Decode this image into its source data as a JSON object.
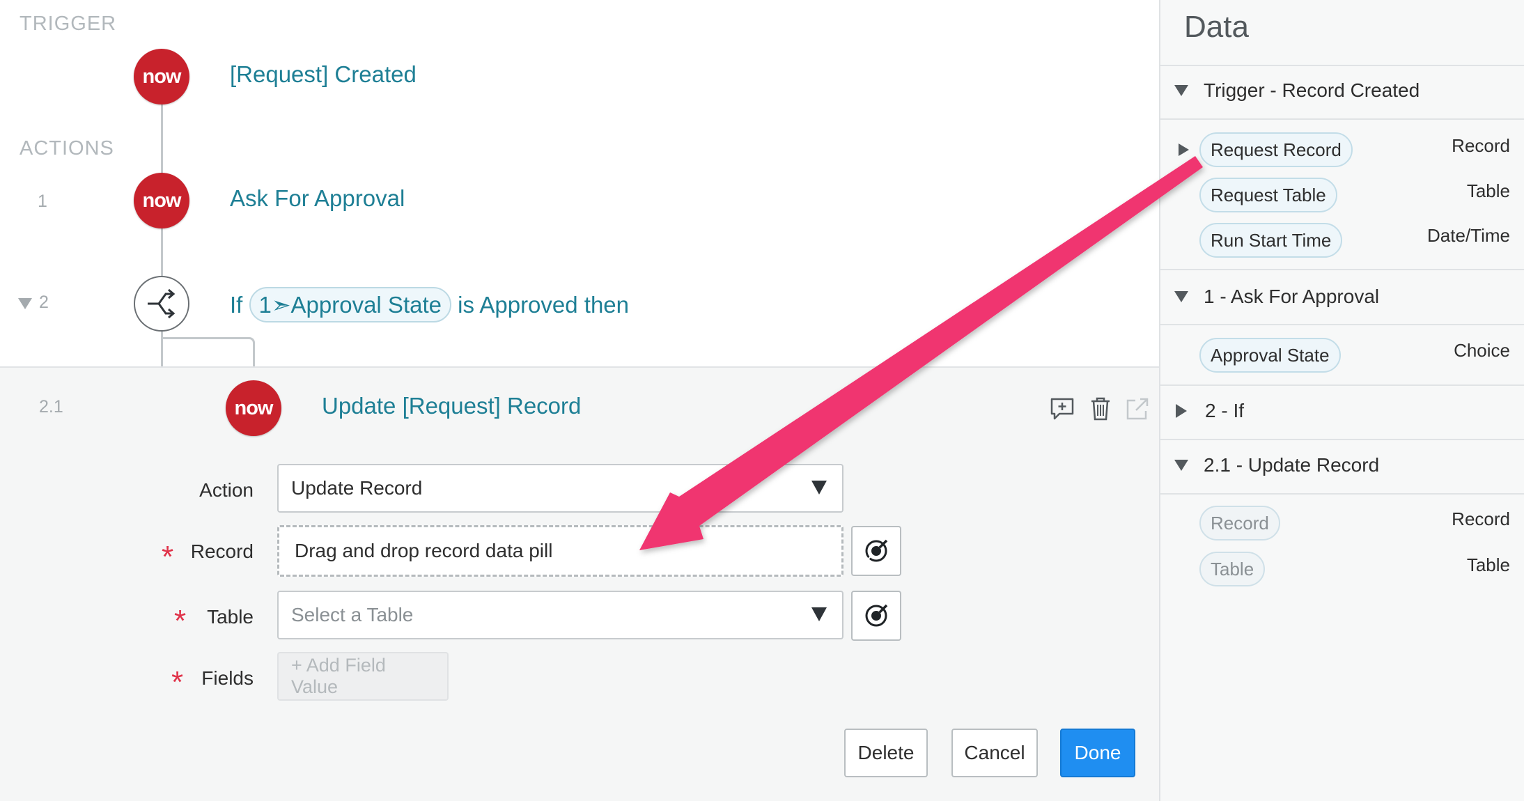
{
  "flow": {
    "trigger_label": "TRIGGER",
    "actions_label": "ACTIONS",
    "now_logo": "now",
    "trigger_title": "[Request] Created",
    "step1_num": "1",
    "step1_title": "Ask For Approval",
    "step2_num": "2",
    "step2_if": "If",
    "step2_pill": "1➣Approval State",
    "step2_rest": "is Approved then"
  },
  "edit": {
    "step_num": "2.1",
    "title": "Update [Request] Record",
    "action_label": "Action",
    "action_value": "Update Record",
    "record_label": "Record",
    "record_placeholder": "Drag and drop record data pill",
    "table_label": "Table",
    "table_placeholder": "Select a Table",
    "fields_label": "Fields",
    "add_field": "+ Add Field Value",
    "required_mark": "*",
    "delete_btn": "Delete",
    "cancel_btn": "Cancel",
    "done_btn": "Done",
    "accent": "#1f8ef1"
  },
  "data_panel": {
    "title": "Data",
    "sections": [
      {
        "title": "Trigger - Record Created",
        "items": [
          {
            "label": "Request Record",
            "type": "Record"
          },
          {
            "label": "Request Table",
            "type": "Table"
          },
          {
            "label": "Run Start Time",
            "type": "Date/Time"
          }
        ]
      },
      {
        "title": "1 - Ask For Approval",
        "items": [
          {
            "label": "Approval State",
            "type": "Choice"
          }
        ]
      },
      {
        "title": "2 - If",
        "items": []
      },
      {
        "title": "2.1 - Update Record",
        "items": [
          {
            "label": "Record",
            "type": "Record"
          },
          {
            "label": "Table",
            "type": "Table"
          }
        ]
      }
    ]
  },
  "annotation": {
    "arrow_color": "#f0356f"
  }
}
